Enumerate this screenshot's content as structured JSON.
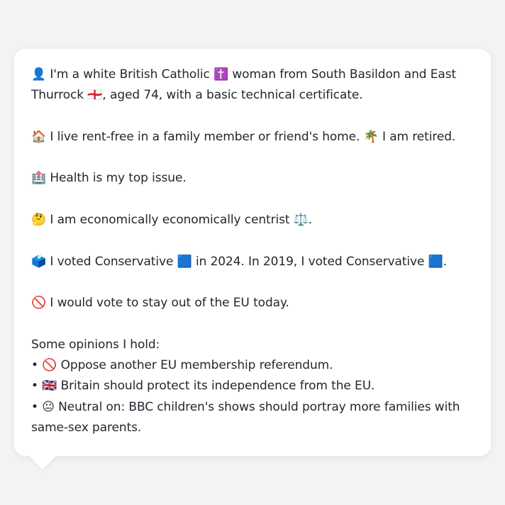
{
  "bio": {
    "identity": "👤 I'm a white British Catholic ✝️ woman from South Basildon and East Thurrock 🏴󠁧󠁢󠁥󠁮󠁧󠁿, aged 74, with a basic technical certificate.",
    "housing": "🏠 I live rent-free in a family member or friend's home. 🌴 I am retired.",
    "top_issue": "🏥 Health is my top issue.",
    "economics": "🤔 I am economically economically centrist ⚖️.",
    "voting": "🗳️ I voted Conservative 🟦 in 2024. In 2019, I voted Conservative 🟦.",
    "eu_vote": "🚫 I would vote to stay out of the EU today."
  },
  "opinions": {
    "heading": "Some opinions I hold:",
    "items": [
      "• 🚫 Oppose another EU membership referendum.",
      "• 🇬🇧 Britain should protect its independence from the EU.",
      "• 😐 Neutral on: BBC children's shows should portray more families with same-sex parents."
    ]
  }
}
